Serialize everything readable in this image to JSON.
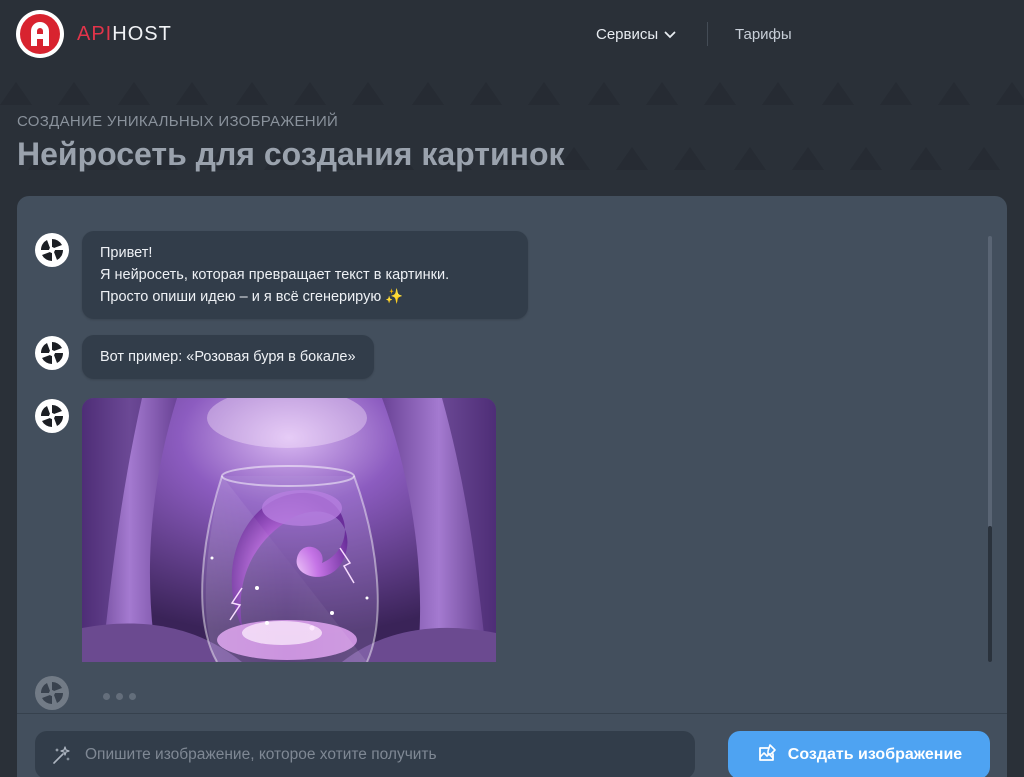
{
  "header": {
    "brand_a": "API",
    "brand_b": "HOST",
    "nav_services": "Сервисы",
    "nav_tariffs": "Тарифы"
  },
  "hero": {
    "subtitle": "СОЗДАНИЕ УНИКАЛЬНЫХ ИЗОБРАЖЕНИЙ",
    "title": "Нейросеть для создания картинок"
  },
  "chat": {
    "messages": [
      {
        "lines": [
          "Привет!",
          "Я нейросеть, которая превращает текст в картинки.",
          "Просто опиши идею – и я всё сгенерирую ✨"
        ]
      },
      {
        "lines": [
          "Вот пример: «Розовая буря в бокале»"
        ]
      }
    ]
  },
  "composer": {
    "placeholder": "Опишите изображение, которое хотите получить",
    "button_label": "Создать изображение"
  },
  "colors": {
    "accent": "#4ea3f2",
    "brand_red": "#e2344a",
    "panel": "#434f5d",
    "bubble": "#323d4a",
    "page_bg": "#2a3038"
  },
  "icons": {
    "logo": "apihost-logo",
    "nav_chevron": "chevron-down-icon",
    "bot_avatar": "swirl-icon",
    "prompt": "sparkles-icon",
    "create": "image-edit-icon"
  }
}
